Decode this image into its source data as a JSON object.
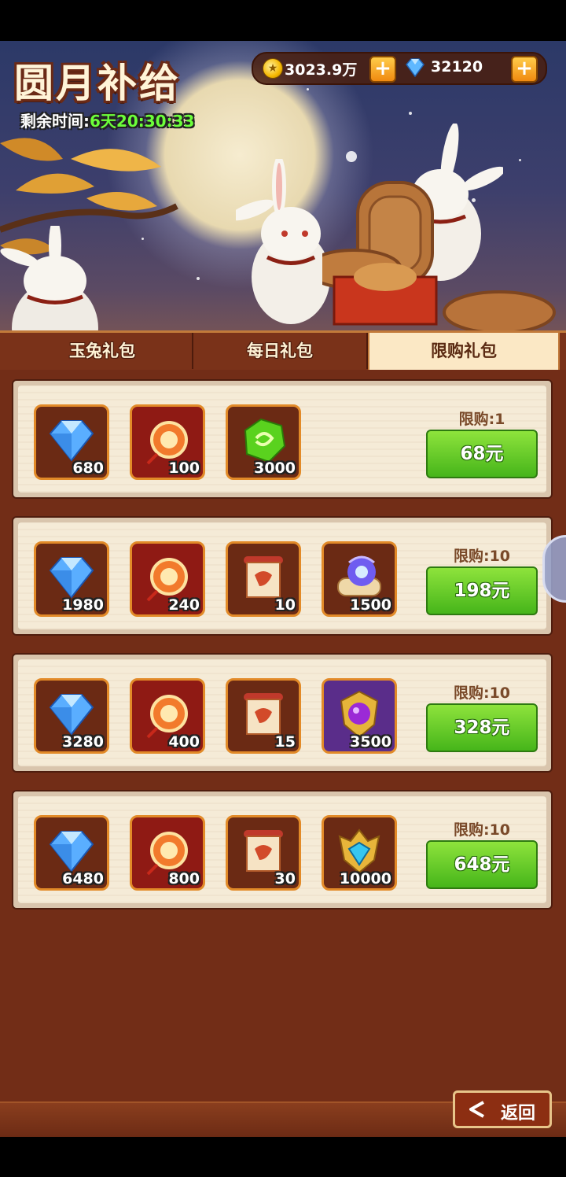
{
  "header": {
    "title": "圆月补给",
    "timer_label": "剩余时间:",
    "timer_value": "6天20:30:33",
    "coins": "3023.9万",
    "gems": "32120"
  },
  "tabs": [
    {
      "label": "玉兔礼包",
      "active": false
    },
    {
      "label": "每日礼包",
      "active": false
    },
    {
      "label": "限购礼包",
      "active": true
    }
  ],
  "packs": [
    {
      "limit": "限购:1",
      "price": "68元",
      "items": [
        {
          "icon": "diamond",
          "qty": "680"
        },
        {
          "icon": "lantern-coin",
          "qty": "100"
        },
        {
          "icon": "green-jade",
          "qty": "3000"
        }
      ]
    },
    {
      "limit": "限购:10",
      "price": "198元",
      "items": [
        {
          "icon": "diamond",
          "qty": "1980"
        },
        {
          "icon": "lantern-coin",
          "qty": "240"
        },
        {
          "icon": "scroll",
          "qty": "10"
        },
        {
          "icon": "spirit-scroll",
          "qty": "1500"
        }
      ]
    },
    {
      "limit": "限购:10",
      "price": "328元",
      "items": [
        {
          "icon": "diamond",
          "qty": "3280"
        },
        {
          "icon": "lantern-coin",
          "qty": "400"
        },
        {
          "icon": "scroll",
          "qty": "15"
        },
        {
          "icon": "purple-emblem",
          "qty": "3500"
        }
      ]
    },
    {
      "limit": "限购:10",
      "price": "648元",
      "items": [
        {
          "icon": "diamond",
          "qty": "6480"
        },
        {
          "icon": "lantern-coin",
          "qty": "800"
        },
        {
          "icon": "scroll",
          "qty": "30"
        },
        {
          "icon": "gold-crest",
          "qty": "10000"
        }
      ]
    }
  ],
  "back_label": "返回",
  "colors": {
    "button_green": "#46b51a",
    "panel_bg": "#722d17",
    "tab_active": "#fbe8c5"
  }
}
